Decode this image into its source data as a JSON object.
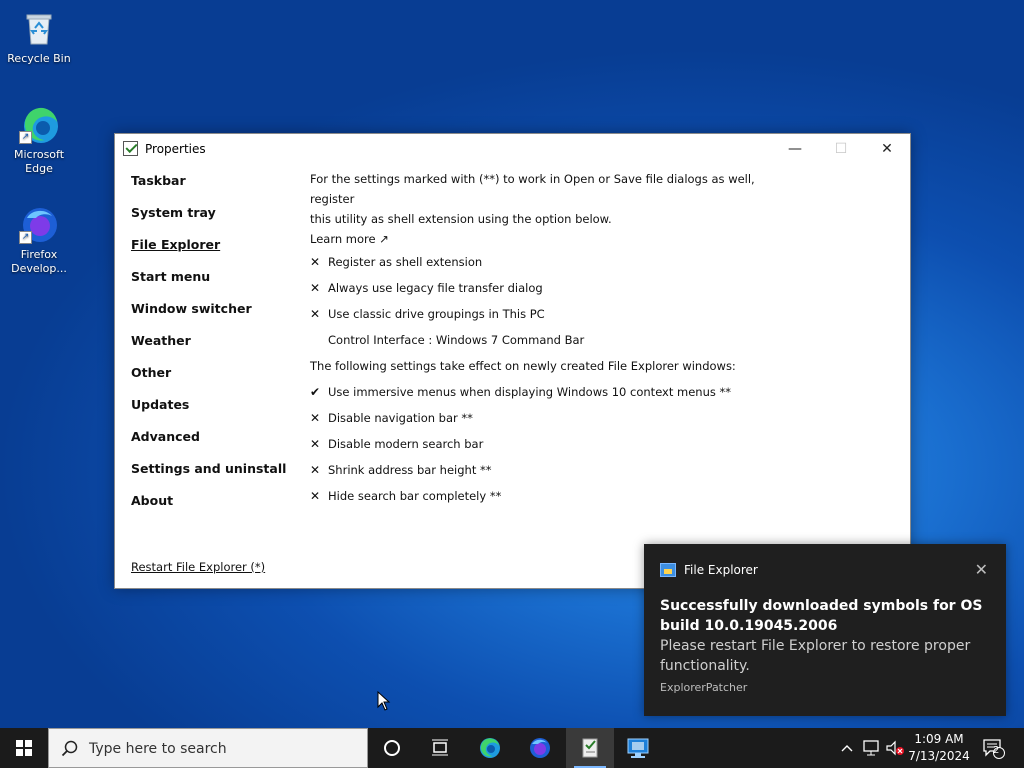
{
  "desktop": {
    "icons": [
      {
        "label_line1": "Recycle Bin",
        "label_line2": ""
      },
      {
        "label_line1": "Microsoft",
        "label_line2": "Edge"
      },
      {
        "label_line1": "Firefox",
        "label_line2": "Develop..."
      }
    ]
  },
  "window": {
    "title": "Properties",
    "controls": {
      "minimize": "—",
      "maximize": "☐",
      "close": "✕"
    },
    "sidebar": [
      "Taskbar",
      "System tray",
      "File Explorer",
      "Start menu",
      "Window switcher",
      "Weather",
      "Other",
      "Updates",
      "Advanced",
      "Settings and uninstall",
      "About"
    ],
    "active_item": "File Explorer",
    "restart_link": "Restart File Explorer (*)",
    "content": {
      "intro_line1": "For the settings marked with (**) to work in Open or Save file dialogs as well, register",
      "intro_line2": "this utility as shell extension using the option below.",
      "learn_more": "Learn more ↗",
      "options_a": [
        {
          "mark": "✕",
          "label": "Register as shell extension"
        },
        {
          "mark": "✕",
          "label": "Always use legacy file transfer dialog"
        },
        {
          "mark": "✕",
          "label": "Use classic drive groupings in This PC"
        }
      ],
      "control_interface": "Control Interface : Windows 7 Command Bar",
      "section_note": "The following settings take effect on newly created File Explorer windows:",
      "options_b": [
        {
          "mark": "✔",
          "label": "Use immersive menus when displaying Windows 10 context menus **"
        },
        {
          "mark": "✕",
          "label": "Disable navigation bar **"
        },
        {
          "mark": "✕",
          "label": "Disable modern search bar"
        },
        {
          "mark": "✕",
          "label": "Shrink address bar height **"
        },
        {
          "mark": "✕",
          "label": "Hide search bar completely **"
        }
      ]
    }
  },
  "toast": {
    "app_name": "File Explorer",
    "close": "✕",
    "headline": "Successfully downloaded symbols for OS build 10.0.19045.2006",
    "body": "Please restart File Explorer to restore proper functionality.",
    "source": "ExplorerPatcher"
  },
  "taskbar": {
    "search_placeholder": "Type here to search",
    "time": "1:09 AM",
    "date": "7/13/2024",
    "notification_count": "2",
    "colors": {
      "taskbar_bg": "#1b1b1b",
      "toast_bg": "#1f1f1f",
      "accent": "#7cb8ff"
    }
  }
}
